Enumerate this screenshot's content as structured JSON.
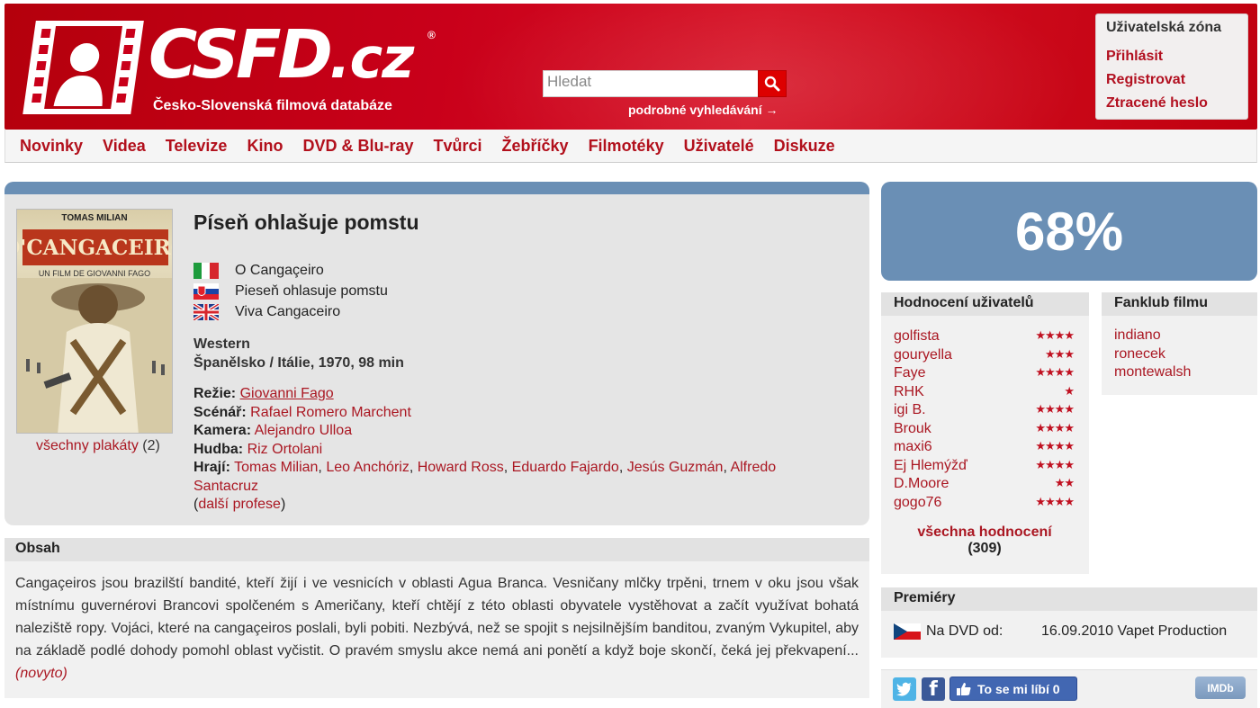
{
  "header": {
    "logo_text": "CSFD",
    "logo_tld": ".cz",
    "logo_reg": "®",
    "logo_subtitle": "Česko-Slovenská filmová databáze",
    "search_placeholder": "Hledat",
    "advanced_search": "podrobné vyhledávání →"
  },
  "user_zone": {
    "title": "Uživatelská zóna",
    "links": [
      "Přihlásit",
      "Registrovat",
      "Ztracené heslo"
    ]
  },
  "nav": [
    "Novinky",
    "Videa",
    "Televize",
    "Kino",
    "DVD & Blu-ray",
    "Tvůrci",
    "Žebříčky",
    "Filmotéky",
    "Uživatelé",
    "Diskuze"
  ],
  "film": {
    "title": "Píseň ohlašuje pomstu",
    "poster": {
      "top_text": "TOMAS MILIAN",
      "title_text": "O'CANGACEIRO",
      "sub_text": "UN FILM DE GIOVANNI FAGO"
    },
    "all_posters_label": "všechny plakáty",
    "all_posters_count": "(2)",
    "alt_titles": [
      {
        "flag": "italy",
        "title": "O Cangaçeiro"
      },
      {
        "flag": "slovakia",
        "title": "Pieseň ohlasuje pomstu"
      },
      {
        "flag": "uk",
        "title": "Viva Cangaceiro"
      }
    ],
    "genre": "Western",
    "origin": "Španělsko / Itálie, 1970, 98 min",
    "credits": {
      "director_label": "Režie:",
      "director": "Giovanni Fago",
      "writer_label": "Scénář:",
      "writer": "Rafael Romero Marchent",
      "camera_label": "Kamera:",
      "camera": "Alejandro Ulloa",
      "music_label": "Hudba:",
      "music": "Riz Ortolani",
      "cast_label": "Hrají:",
      "cast": [
        "Tomas Milian",
        "Leo Anchóriz",
        "Howard Ross",
        "Eduardo Fajardo",
        "Jesús Guzmán",
        "Alfredo Santacruz"
      ],
      "more_label": "další profese"
    }
  },
  "obsah": {
    "heading": "Obsah",
    "text": "Cangaçeiros jsou brazilští bandité, kteří žijí i ve vesnicích v oblasti Agua Branca. Vesničany mlčky trpěni, trnem v oku jsou však místnímu guvernérovi Brancovi spolčeném s Američany, kteří chtějí z této oblasti obyvatele vystěhovat a začít využívat bohatá naleziště ropy. Vojáci, které na cangaçeiros poslali, byli pobiti. Nezbývá, než se spojit s nejsilnějším banditou, zvaným Vykupitel, aby na základě podlé dohody pomohl oblast vyčistit. O pravém smyslu akce nemá ani ponětí a když boje skončí, čeká jej překvapení...",
    "more": "(novyto)"
  },
  "rating": {
    "value": "68%"
  },
  "user_ratings": {
    "heading": "Hodnocení uživatelů",
    "items": [
      {
        "user": "golfista",
        "stars": "★★★★"
      },
      {
        "user": "gouryella",
        "stars": "★★★"
      },
      {
        "user": "Faye",
        "stars": "★★★★"
      },
      {
        "user": "RHK",
        "stars": "★"
      },
      {
        "user": "igi B.",
        "stars": "★★★★"
      },
      {
        "user": "Brouk",
        "stars": "★★★★"
      },
      {
        "user": "maxi6",
        "stars": "★★★★"
      },
      {
        "user": "Ej Hlemýžď",
        "stars": "★★★★"
      },
      {
        "user": "D.Moore",
        "stars": "★★"
      },
      {
        "user": "gogo76",
        "stars": "★★★★"
      }
    ],
    "all_label": "všechna hodnocení",
    "all_count": "(309)"
  },
  "fanklub": {
    "heading": "Fanklub filmu",
    "members": [
      "indiano",
      "ronecek",
      "montewalsh"
    ]
  },
  "premiery": {
    "heading": "Premiéry",
    "label": "Na DVD od:",
    "value": "16.09.2010 Vapet Production"
  },
  "social": {
    "like_label": "To se mi líbí 0",
    "imdb_label": "IMDb"
  },
  "colors": {
    "brand_red": "#c9001a",
    "link_red": "#aa1722",
    "rating_blue": "#6a8fb5"
  }
}
